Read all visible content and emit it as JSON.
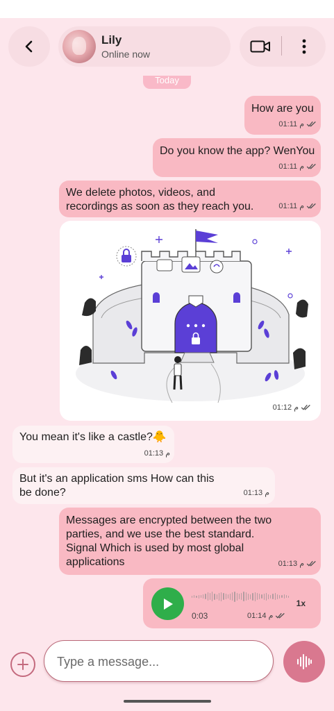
{
  "header": {
    "contact_name": "Lily",
    "contact_status": "Online now",
    "icons": [
      "back-icon",
      "video-call-icon",
      "more-vertical-icon"
    ]
  },
  "date_chip": "Today",
  "messages": [
    {
      "text": "How are you",
      "time": "01:11 م",
      "direction": "outgoing",
      "status": "read"
    },
    {
      "text": "Do you know the app? WenYou",
      "time": "01:11 م",
      "direction": "outgoing",
      "status": "read"
    },
    {
      "text": "We delete photos, videos, and recordings as soon as they reach you.",
      "time": "01:11 م",
      "direction": "outgoing",
      "status": "read"
    },
    {
      "type": "image",
      "time": "01:12 م",
      "direction": "outgoing",
      "status": "read"
    },
    {
      "text": "You mean it's like a castle?🐥",
      "time": "01:13 م",
      "direction": "incoming"
    },
    {
      "text": "But it's an application sms How can this be done?",
      "time": "01:13 م",
      "direction": "incoming"
    },
    {
      "text": "Messages are encrypted between the two parties, and we use the best standard. Signal Which is used by most global applications",
      "time": "01:13 م",
      "direction": "outgoing",
      "status": "read"
    },
    {
      "type": "voice",
      "duration": "0:03",
      "speed": "1x",
      "time": "01:14 م",
      "direction": "outgoing",
      "status": "read"
    }
  ],
  "composer": {
    "placeholder": "Type a message...",
    "icons": [
      "add-icon",
      "voice-record-icon"
    ]
  },
  "colors": {
    "background": "#fde6ec",
    "outgoing_bubble": "#f9b9c3",
    "incoming_bubble": "#fdf1f3",
    "accent": "#d9788f",
    "play_button": "#2fae4a",
    "castle_purple": "#5b3fd6"
  }
}
